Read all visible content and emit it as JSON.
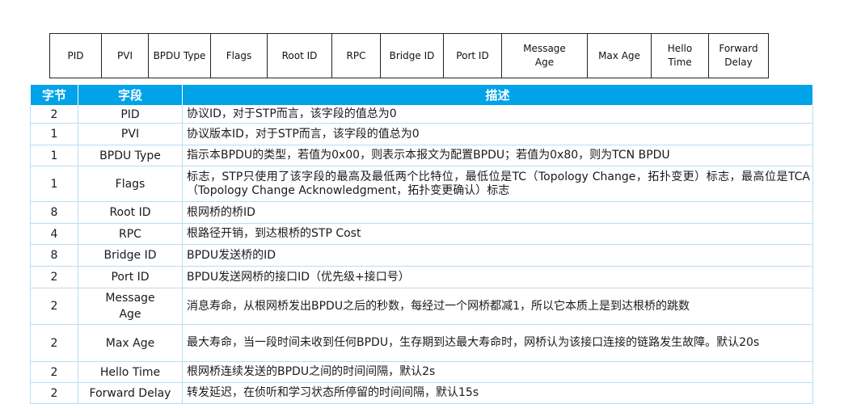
{
  "header_fields": [
    "PID",
    "PVI",
    "BPDU Type",
    "Flags",
    "Root ID",
    "RPC",
    "Bridge ID",
    "Port ID",
    "Message\nAge",
    "Max Age",
    "Hello\nTime",
    "Forward\nDelay"
  ],
  "table": {
    "columns": [
      "字节",
      "字段",
      "描述"
    ],
    "rows": [
      {
        "bytes": "2",
        "field": "PID",
        "desc": "协议ID，对于STP而言，该字段的值总为0"
      },
      {
        "bytes": "1",
        "field": "PVI",
        "desc": "协议版本ID，对于STP而言，该字段的值总为0"
      },
      {
        "bytes": "1",
        "field": "BPDU Type",
        "desc": "指示本BPDU的类型，若值为0x00，则表示本报文为配置BPDU；若值为0x80，则为TCN BPDU"
      },
      {
        "bytes": "1",
        "field": "Flags",
        "desc": "标志，STP只使用了该字段的最高及最低两个比特位，最低位是TC（Topology Change，拓扑变更）标志，最高位是TCA（Topology Change Acknowledgment，拓扑变更确认）标志"
      },
      {
        "bytes": "8",
        "field": "Root ID",
        "desc": "根网桥的桥ID"
      },
      {
        "bytes": "4",
        "field": "RPC",
        "desc": "根路径开销，到达根桥的STP Cost"
      },
      {
        "bytes": "8",
        "field": "Bridge ID",
        "desc": "BPDU发送桥的ID"
      },
      {
        "bytes": "2",
        "field": "Port ID",
        "desc": "BPDU发送网桥的接口ID（优先级+接口号）"
      },
      {
        "bytes": "2",
        "field": "Message\nAge",
        "desc": "消息寿命，从根网桥发出BPDU之后的秒数，每经过一个网桥都减1，所以它本质上是到达根桥的跳数"
      },
      {
        "bytes": "2",
        "field": "Max Age",
        "desc": "最大寿命，当一段时间未收到任何BPDU，生存期到达最大寿命时，网桥认为该接口连接的链路发生故障。默认20s"
      },
      {
        "bytes": "2",
        "field": "Hello Time",
        "desc": "根网桥连续发送的BPDU之间的时间间隔，默认2s"
      },
      {
        "bytes": "2",
        "field": "Forward Delay",
        "desc": "转发延迟，在侦听和学习状态所停留的时间间隔，默认15s"
      }
    ]
  },
  "colors": {
    "header_bg": "#00a2e8",
    "header_text": "#ffffff",
    "grid_line": "#b7def2"
  }
}
